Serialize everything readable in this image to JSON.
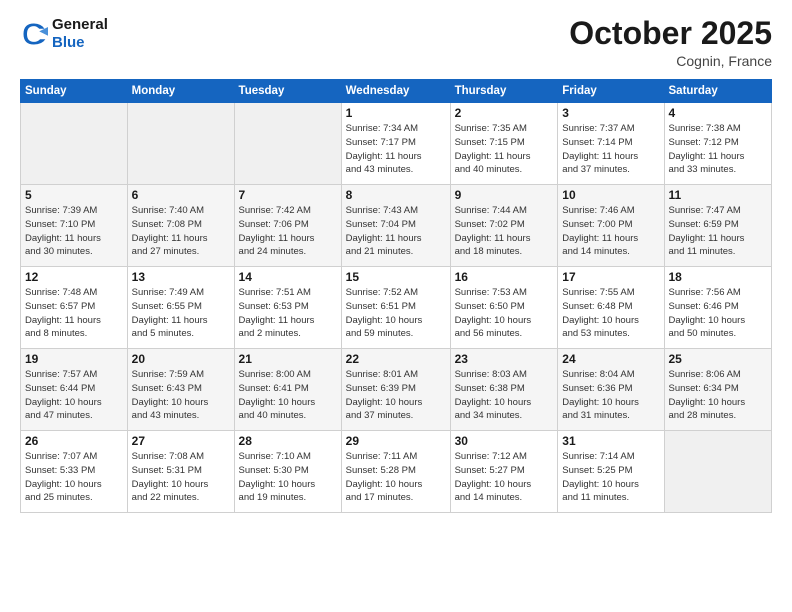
{
  "header": {
    "logo_line1": "General",
    "logo_line2": "Blue",
    "month": "October 2025",
    "location": "Cognin, France"
  },
  "days_of_week": [
    "Sunday",
    "Monday",
    "Tuesday",
    "Wednesday",
    "Thursday",
    "Friday",
    "Saturday"
  ],
  "weeks": [
    [
      {
        "day": "",
        "info": ""
      },
      {
        "day": "",
        "info": ""
      },
      {
        "day": "",
        "info": ""
      },
      {
        "day": "1",
        "info": "Sunrise: 7:34 AM\nSunset: 7:17 PM\nDaylight: 11 hours\nand 43 minutes."
      },
      {
        "day": "2",
        "info": "Sunrise: 7:35 AM\nSunset: 7:15 PM\nDaylight: 11 hours\nand 40 minutes."
      },
      {
        "day": "3",
        "info": "Sunrise: 7:37 AM\nSunset: 7:14 PM\nDaylight: 11 hours\nand 37 minutes."
      },
      {
        "day": "4",
        "info": "Sunrise: 7:38 AM\nSunset: 7:12 PM\nDaylight: 11 hours\nand 33 minutes."
      }
    ],
    [
      {
        "day": "5",
        "info": "Sunrise: 7:39 AM\nSunset: 7:10 PM\nDaylight: 11 hours\nand 30 minutes."
      },
      {
        "day": "6",
        "info": "Sunrise: 7:40 AM\nSunset: 7:08 PM\nDaylight: 11 hours\nand 27 minutes."
      },
      {
        "day": "7",
        "info": "Sunrise: 7:42 AM\nSunset: 7:06 PM\nDaylight: 11 hours\nand 24 minutes."
      },
      {
        "day": "8",
        "info": "Sunrise: 7:43 AM\nSunset: 7:04 PM\nDaylight: 11 hours\nand 21 minutes."
      },
      {
        "day": "9",
        "info": "Sunrise: 7:44 AM\nSunset: 7:02 PM\nDaylight: 11 hours\nand 18 minutes."
      },
      {
        "day": "10",
        "info": "Sunrise: 7:46 AM\nSunset: 7:00 PM\nDaylight: 11 hours\nand 14 minutes."
      },
      {
        "day": "11",
        "info": "Sunrise: 7:47 AM\nSunset: 6:59 PM\nDaylight: 11 hours\nand 11 minutes."
      }
    ],
    [
      {
        "day": "12",
        "info": "Sunrise: 7:48 AM\nSunset: 6:57 PM\nDaylight: 11 hours\nand 8 minutes."
      },
      {
        "day": "13",
        "info": "Sunrise: 7:49 AM\nSunset: 6:55 PM\nDaylight: 11 hours\nand 5 minutes."
      },
      {
        "day": "14",
        "info": "Sunrise: 7:51 AM\nSunset: 6:53 PM\nDaylight: 11 hours\nand 2 minutes."
      },
      {
        "day": "15",
        "info": "Sunrise: 7:52 AM\nSunset: 6:51 PM\nDaylight: 10 hours\nand 59 minutes."
      },
      {
        "day": "16",
        "info": "Sunrise: 7:53 AM\nSunset: 6:50 PM\nDaylight: 10 hours\nand 56 minutes."
      },
      {
        "day": "17",
        "info": "Sunrise: 7:55 AM\nSunset: 6:48 PM\nDaylight: 10 hours\nand 53 minutes."
      },
      {
        "day": "18",
        "info": "Sunrise: 7:56 AM\nSunset: 6:46 PM\nDaylight: 10 hours\nand 50 minutes."
      }
    ],
    [
      {
        "day": "19",
        "info": "Sunrise: 7:57 AM\nSunset: 6:44 PM\nDaylight: 10 hours\nand 47 minutes."
      },
      {
        "day": "20",
        "info": "Sunrise: 7:59 AM\nSunset: 6:43 PM\nDaylight: 10 hours\nand 43 minutes."
      },
      {
        "day": "21",
        "info": "Sunrise: 8:00 AM\nSunset: 6:41 PM\nDaylight: 10 hours\nand 40 minutes."
      },
      {
        "day": "22",
        "info": "Sunrise: 8:01 AM\nSunset: 6:39 PM\nDaylight: 10 hours\nand 37 minutes."
      },
      {
        "day": "23",
        "info": "Sunrise: 8:03 AM\nSunset: 6:38 PM\nDaylight: 10 hours\nand 34 minutes."
      },
      {
        "day": "24",
        "info": "Sunrise: 8:04 AM\nSunset: 6:36 PM\nDaylight: 10 hours\nand 31 minutes."
      },
      {
        "day": "25",
        "info": "Sunrise: 8:06 AM\nSunset: 6:34 PM\nDaylight: 10 hours\nand 28 minutes."
      }
    ],
    [
      {
        "day": "26",
        "info": "Sunrise: 7:07 AM\nSunset: 5:33 PM\nDaylight: 10 hours\nand 25 minutes."
      },
      {
        "day": "27",
        "info": "Sunrise: 7:08 AM\nSunset: 5:31 PM\nDaylight: 10 hours\nand 22 minutes."
      },
      {
        "day": "28",
        "info": "Sunrise: 7:10 AM\nSunset: 5:30 PM\nDaylight: 10 hours\nand 19 minutes."
      },
      {
        "day": "29",
        "info": "Sunrise: 7:11 AM\nSunset: 5:28 PM\nDaylight: 10 hours\nand 17 minutes."
      },
      {
        "day": "30",
        "info": "Sunrise: 7:12 AM\nSunset: 5:27 PM\nDaylight: 10 hours\nand 14 minutes."
      },
      {
        "day": "31",
        "info": "Sunrise: 7:14 AM\nSunset: 5:25 PM\nDaylight: 10 hours\nand 11 minutes."
      },
      {
        "day": "",
        "info": ""
      }
    ]
  ]
}
